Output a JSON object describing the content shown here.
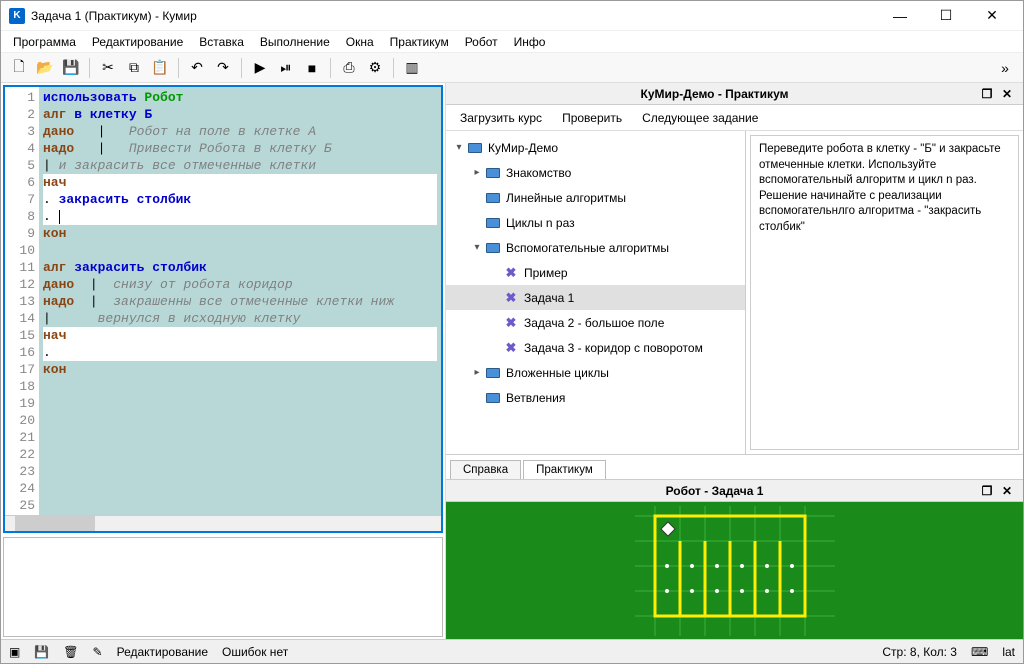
{
  "titlebar": {
    "title": "Задача 1  (Практикум) - Кумир"
  },
  "menu": {
    "program": "Программа",
    "edit": "Редактирование",
    "insert": "Вставка",
    "run": "Выполнение",
    "windows": "Окна",
    "practicum": "Практикум",
    "robot": "Робот",
    "info": "Инфо"
  },
  "code": {
    "lines": [
      1,
      2,
      3,
      4,
      5,
      6,
      7,
      8,
      9,
      10,
      11,
      12,
      13,
      14,
      15,
      16,
      17,
      18,
      19,
      20,
      21,
      22,
      23,
      24,
      25
    ],
    "l1_a": "использовать ",
    "l1_b": "Робот",
    "l2_a": "алг ",
    "l2_b": "в клетку Б",
    "l3_a": "дано",
    "l3_b": "   Робот на поле в клетке А",
    "l4_a": "надо",
    "l4_b": "   Привести Робота в клетку Б",
    "l5": " и закрасить все отмеченные клетки",
    "l6": "нач",
    "l7_a": ". ",
    "l7_b": "закрасить столбик",
    "l8": ".",
    "l9": "кон",
    "l11_a": "алг ",
    "l11_b": "закрасить столбик",
    "l12_a": "дано",
    "l12_b": "  снизу от робота коридор",
    "l13_a": "надо",
    "l13_b": "  закрашенны все отмеченные клетки ниж",
    "l14": "      вернулся в исходную клетку",
    "l15": "нач",
    "l16": ".",
    "l17": "кон"
  },
  "practicum": {
    "title": "КуМир-Демо - Практикум",
    "load": "Загрузить курс",
    "check": "Проверить",
    "next": "Следующее задание",
    "tabs": {
      "help": "Справка",
      "practicum": "Практикум"
    },
    "tree": {
      "root": "КуМир-Демо",
      "intro": "Знакомство",
      "linear": "Линейные алгоритмы",
      "cycles": "Циклы n раз",
      "aux": "Вспомогательные алгоритмы",
      "example": "Пример",
      "task1": "Задача 1",
      "task2": "Задача 2 - большое поле",
      "task3": "Задача 3 - коридор с поворотом",
      "nested": "Вложенные циклы",
      "branch": "Ветвления"
    },
    "description": "Переведите робота в клетку - \"Б\" и закрасьте отмеченные клетки. Используйте вспомогательный алгоритм и цикл n раз. Решение начинайте с реализации вспомогательнлго алгоритма - \"закрасить столбик\""
  },
  "robot": {
    "title": "Робот - Задача 1"
  },
  "status": {
    "mode": "Редактирование",
    "errors": "Ошибок нет",
    "pos": "Стр: 8, Кол: 3",
    "lang": "lat"
  }
}
